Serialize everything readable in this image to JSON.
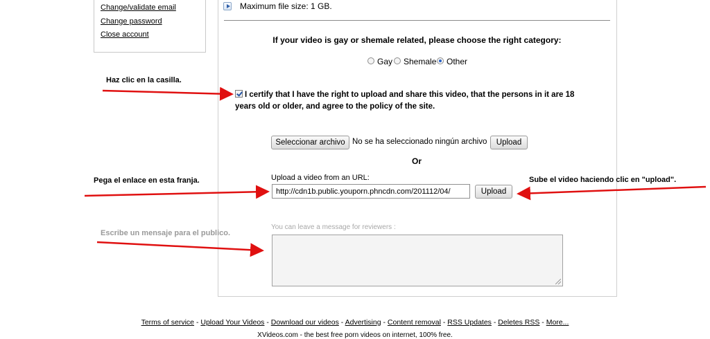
{
  "account_links": [
    "Change/validate email",
    "Change password",
    "Close account"
  ],
  "upload_panel": {
    "max_size": "Maximum file size: 1 GB.",
    "category_title": "If your video is gay or shemale related, please choose the right category:",
    "categories": [
      "Gay",
      "Shemale",
      "Other"
    ],
    "selected_category": "Other",
    "certify_line1": "I certify that I have the right to upload and share this video, that the persons in it are 18",
    "certify_line2": "years old or older, and agree to the policy of the site.",
    "file_button": "Seleccionar archivo",
    "no_file_text": "No se ha seleccionado ningún archivo",
    "upload_button": "Upload",
    "or_text": "Or",
    "url_label": "Upload a video from an URL:",
    "url_value": "http://cdn1b.public.youporn.phncdn.com/201112/04/",
    "url_upload_button": "Upload",
    "message_placeholder": "You can leave a message for reviewers :"
  },
  "annotations": {
    "checkbox_note": "Haz clic en la casilla.",
    "url_note": "Pega el enlace en esta franja.",
    "upload_note": "Sube el video haciendo clic en \"upload\".",
    "message_note": "Escribe un mensaje para el publico."
  },
  "annotation_color": "#e01010",
  "footer": {
    "links": [
      "Terms of service",
      "Upload Your Videos",
      "Download our videos",
      "Advertising",
      "Content removal",
      "RSS Updates",
      "Deletes RSS",
      "More..."
    ],
    "tagline": "XVideos.com - the best free porn videos on internet, 100% free."
  }
}
